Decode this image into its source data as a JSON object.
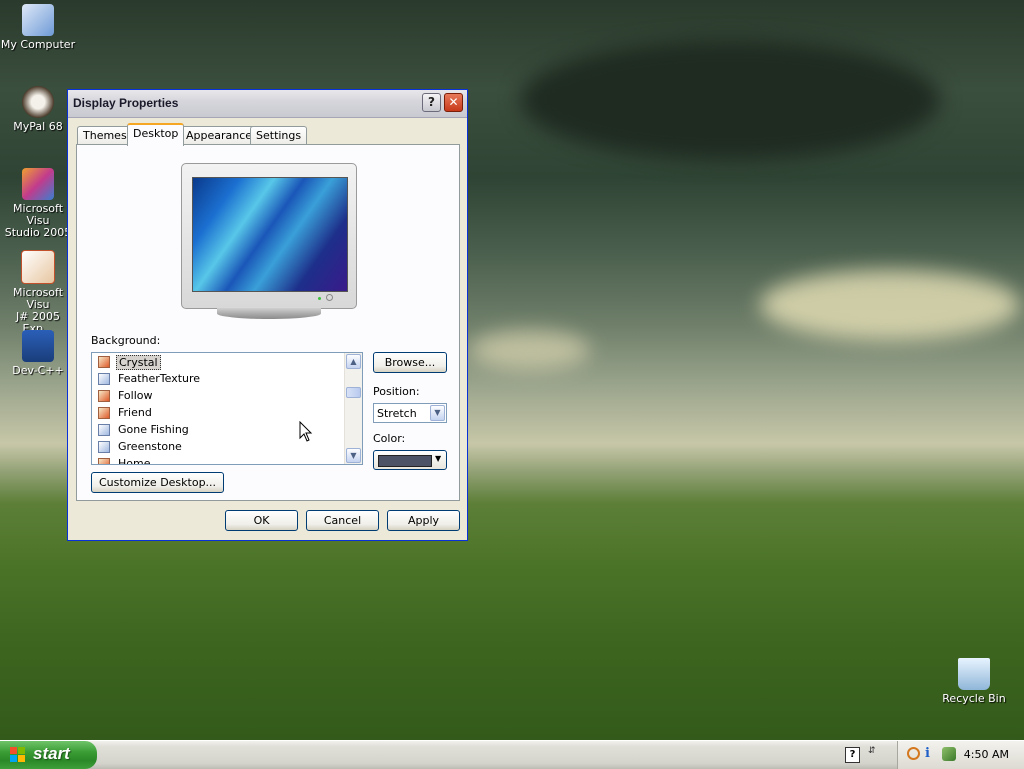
{
  "desktop_icons": [
    {
      "id": "my-computer",
      "label": "My Computer"
    },
    {
      "id": "mypal",
      "label": "MyPal 68"
    },
    {
      "id": "visual-studio",
      "label": "Microsoft Visu\nStudio 2005"
    },
    {
      "id": "visual-jsharp",
      "label": "Microsoft Visu\nJ# 2005 Exp..."
    },
    {
      "id": "dev-cpp",
      "label": "Dev-C++"
    },
    {
      "id": "recycle-bin",
      "label": "Recycle Bin"
    }
  ],
  "window": {
    "title": "Display Properties",
    "tabs": [
      "Themes",
      "Desktop",
      "Appearance",
      "Settings"
    ],
    "active_tab": "Desktop",
    "background_label": "Background:",
    "background_items": [
      {
        "label": "Crystal",
        "icon": "image-icon",
        "selected": true
      },
      {
        "label": "FeatherTexture",
        "icon": "paint-icon",
        "selected": false
      },
      {
        "label": "Follow",
        "icon": "image-icon",
        "selected": false
      },
      {
        "label": "Friend",
        "icon": "image-icon",
        "selected": false
      },
      {
        "label": "Gone Fishing",
        "icon": "paint-icon",
        "selected": false
      },
      {
        "label": "Greenstone",
        "icon": "paint-icon",
        "selected": false
      },
      {
        "label": "Home",
        "icon": "image-icon",
        "selected": false
      }
    ],
    "browse_label": "Browse...",
    "position_label": "Position:",
    "position_value": "Stretch",
    "color_label": "Color:",
    "color_value": "#4d5366",
    "customize_label": "Customize Desktop...",
    "ok_label": "OK",
    "cancel_label": "Cancel",
    "apply_label": "Apply"
  },
  "taskbar": {
    "start_label": "start",
    "clock": "4:50 AM"
  }
}
